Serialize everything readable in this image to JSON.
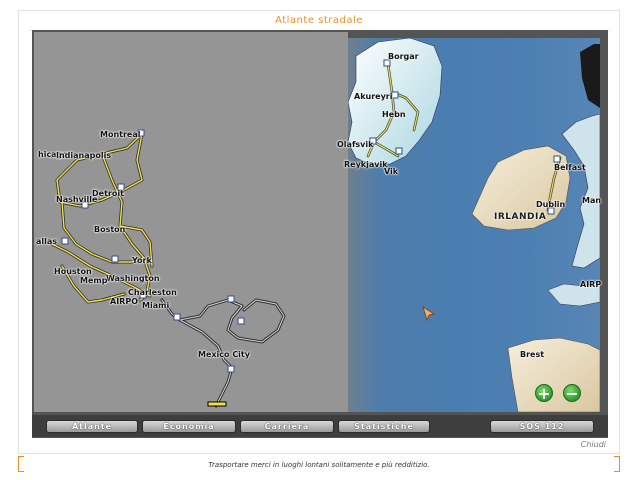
{
  "window": {
    "title": "Atlante stradale"
  },
  "map": {
    "labels_west": [
      {
        "id": "montreal",
        "text": "Montreal"
      },
      {
        "id": "chicago",
        "text": "hicago"
      },
      {
        "id": "indianapolis",
        "text": "Indianapolis"
      },
      {
        "id": "detroit",
        "text": "Detroit"
      },
      {
        "id": "nashville",
        "text": "Nashville"
      },
      {
        "id": "boston",
        "text": "Boston"
      },
      {
        "id": "dallas",
        "text": "allas"
      },
      {
        "id": "york",
        "text": "York"
      },
      {
        "id": "houston",
        "text": "Houston"
      },
      {
        "id": "washington",
        "text": "Washington"
      },
      {
        "id": "memphis",
        "text": "Memp"
      },
      {
        "id": "charleston",
        "text": "Charleston"
      },
      {
        "id": "airport",
        "text": "AIRPO"
      },
      {
        "id": "miami",
        "text": "Miami"
      },
      {
        "id": "mexicocity",
        "text": "Mexico City"
      }
    ],
    "labels_east": [
      {
        "id": "borgar",
        "text": "Borgar"
      },
      {
        "id": "akureyri",
        "text": "Akureyri"
      },
      {
        "id": "hebn",
        "text": "Hebn"
      },
      {
        "id": "olafsvik",
        "text": "Olafsvik"
      },
      {
        "id": "reykjavik",
        "text": "Reykjavik"
      },
      {
        "id": "vik",
        "text": "Vik"
      },
      {
        "id": "irlandia",
        "text": "IRLANDIA"
      },
      {
        "id": "belfast",
        "text": "Belfast"
      },
      {
        "id": "dublin",
        "text": "Dublin"
      },
      {
        "id": "man",
        "text": "Man"
      },
      {
        "id": "airp",
        "text": "AIRP"
      },
      {
        "id": "brest",
        "text": "Brest"
      }
    ],
    "zoom_in_symbol": "+",
    "zoom_out_symbol": "−"
  },
  "tabs": [
    {
      "id": "atlante",
      "label": "Atlante"
    },
    {
      "id": "economia",
      "label": "Economia"
    },
    {
      "id": "carriera",
      "label": "Carriera"
    },
    {
      "id": "statistiche",
      "label": "Statistiche"
    },
    {
      "id": "sos",
      "label": "SOS  112"
    }
  ],
  "close_label": "Chiudi",
  "status_bar": {
    "text": "Trasportare merci in luoghi lontani solitamente e più redditizio."
  },
  "colors": {
    "accent": "#e8902a",
    "road": "#f2e14a",
    "sea": "#4a7db0",
    "land": "#e9dfc6"
  }
}
